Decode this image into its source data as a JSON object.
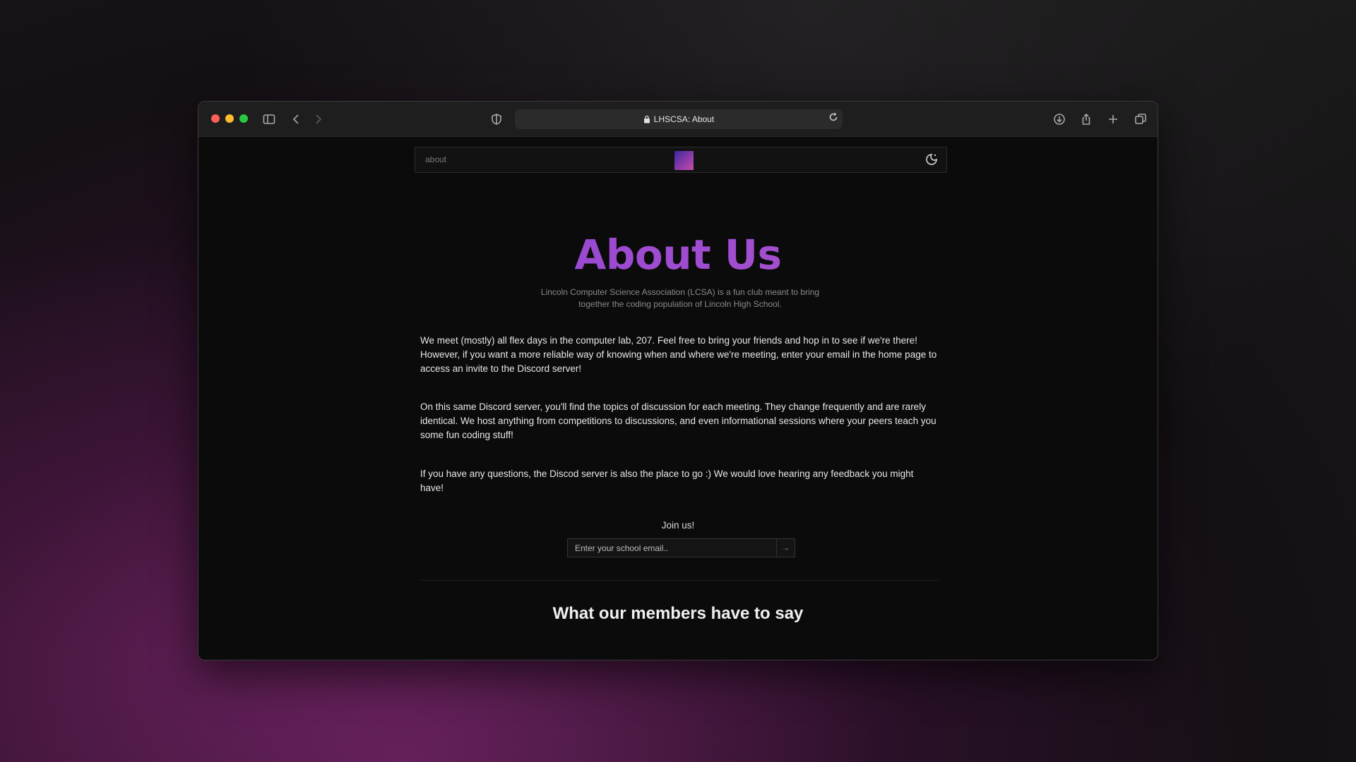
{
  "browser": {
    "tab_title": "LHSCSA: About"
  },
  "navbar": {
    "crumb": "about"
  },
  "hero": {
    "title": "About Us",
    "subtitle": "Lincoln Computer Science Association (LCSA) is a fun club meant to bring together the coding population of Lincoln High School."
  },
  "paragraphs": [
    "We meet (mostly) all flex days in the computer lab, 207. Feel free to bring your friends and hop in to see if we're there! However, if you want a more reliable way of knowing when and where we're meeting, enter your email in the home page to access an invite to the Discord server!",
    "On this same Discord server, you'll find the topics of discussion for each meeting. They change frequently and are rarely identical. We host anything from competitions to discussions, and even informational sessions where your peers teach you some fun coding stuff!",
    "If you have any questions, the Discod server is also the place to go :) We would love hearing any feedback you might have!"
  ],
  "join": {
    "label": "Join us!",
    "email_placeholder": "Enter your school email..",
    "submit_glyph": "→"
  },
  "testimonials": {
    "title": "What our members have to say"
  },
  "colors": {
    "accent_start": "#7b44d6",
    "accent_end": "#b356cc",
    "background": "#0b0b0b"
  },
  "icons": {
    "sidebar": "sidebar-icon",
    "back": "chevron-left-icon",
    "forward": "chevron-right-icon",
    "shield": "shield-icon",
    "lock": "lock-icon",
    "reload": "reload-icon",
    "download": "download-icon",
    "share": "share-icon",
    "new_tab": "plus-icon",
    "tabs": "tabs-overview-icon",
    "theme": "theme-toggle-icon"
  }
}
